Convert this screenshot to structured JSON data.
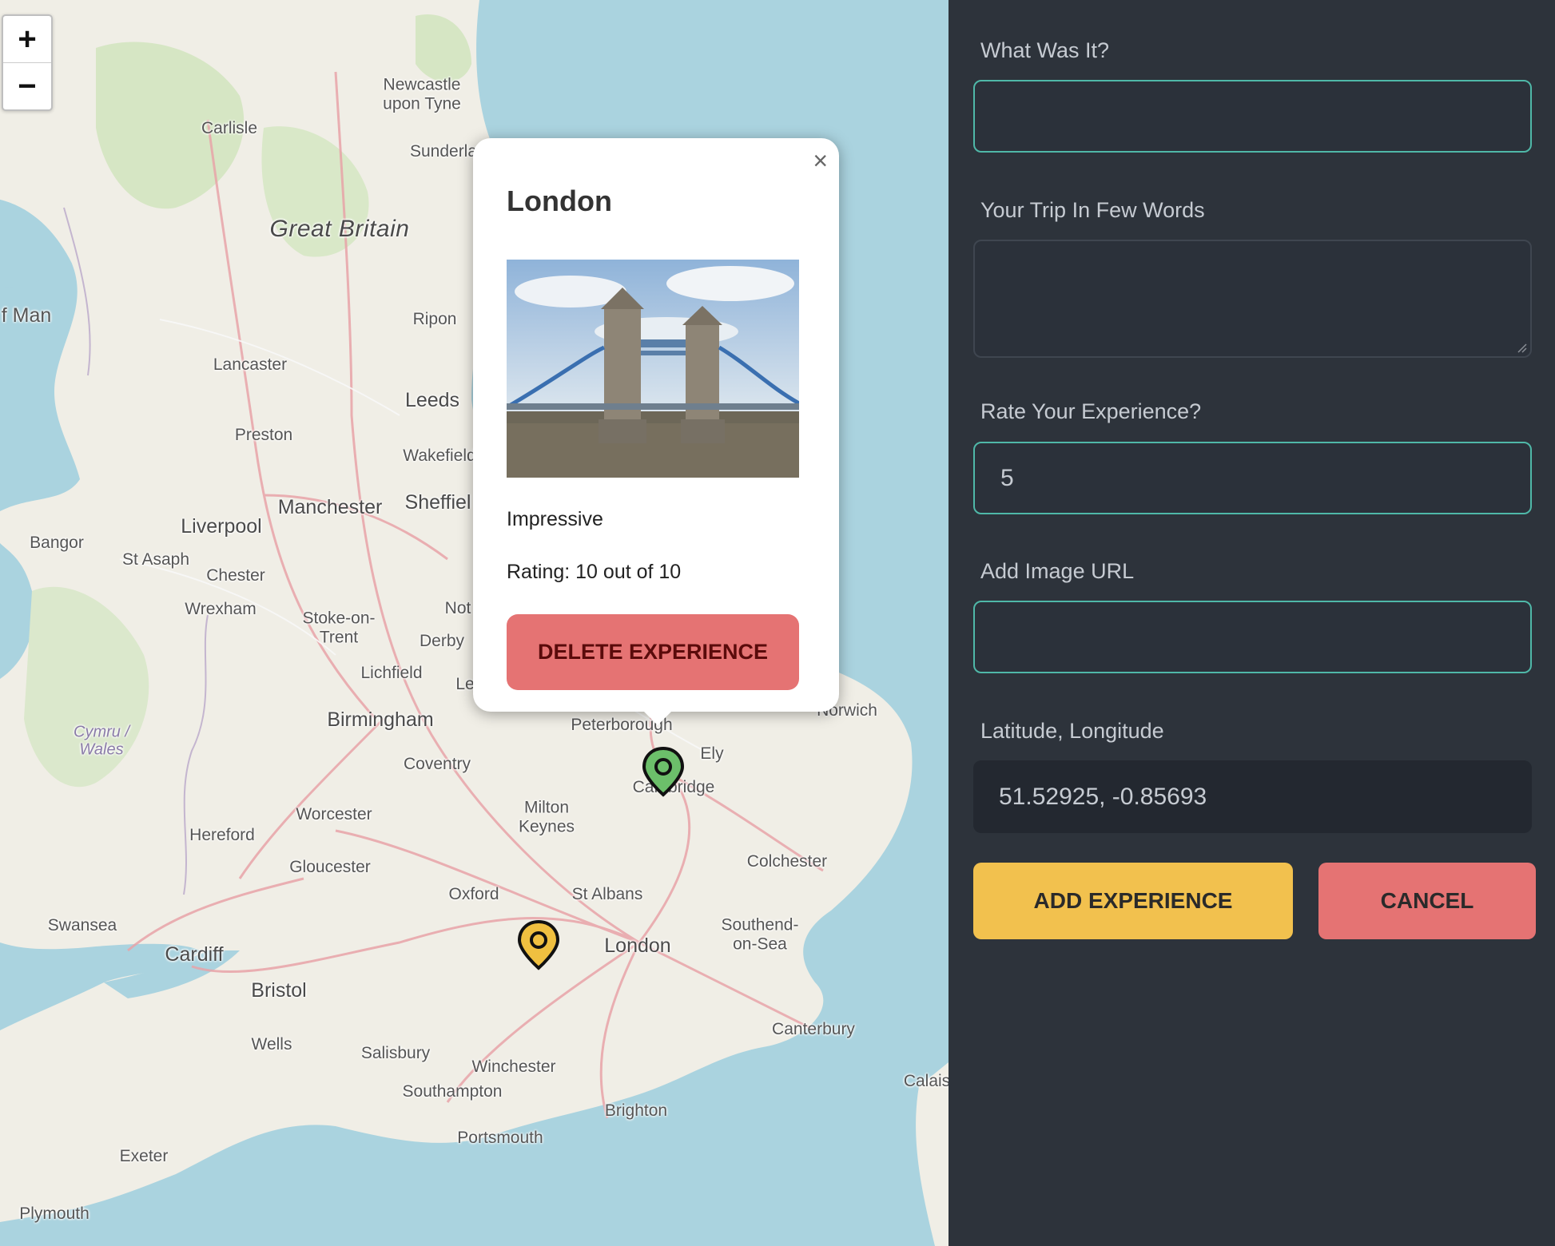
{
  "map": {
    "zoom_in": "+",
    "zoom_out": "−",
    "places": {
      "newcastle": "Newcastle\nupon Tyne",
      "sunderland": "Sunderla",
      "carlisle": "Carlisle",
      "great_britain": "Great Britain",
      "man": "f Man",
      "ripon": "Ripon",
      "lancaster": "Lancaster",
      "leeds": "Leeds",
      "preston": "Preston",
      "wakefield": "Wakefield",
      "manchester": "Manchester",
      "sheffield": "Sheffiel",
      "liverpool": "Liverpool",
      "bangor": "Bangor",
      "st_asaph": "St Asaph",
      "chester": "Chester",
      "wrexham": "Wrexham",
      "stoke": "Stoke-on-\nTrent",
      "nottingham": "Not",
      "derby": "Derby",
      "lichfield": "Lichfield",
      "leicester": "Le",
      "birmingham": "Birmingham",
      "cymru": "Cymru /\nWales",
      "coventry": "Coventry",
      "peterborough": "Peterborough",
      "norwich": "Norwich",
      "ely": "Ely",
      "cambridge": "Cambridge",
      "worcester": "Worcester",
      "milton_keynes": "Milton\nKeynes",
      "hereford": "Hereford",
      "gloucester": "Gloucester",
      "colchester": "Colchester",
      "oxford": "Oxford",
      "st_albans": "St Albans",
      "swansea": "Swansea",
      "cardiff": "Cardiff",
      "london": "London",
      "southend": "Southend-\non-Sea",
      "bristol": "Bristol",
      "wells": "Wells",
      "salisbury": "Salisbury",
      "winchester": "Winchester",
      "canterbury": "Canterbury",
      "southampton": "Southampton",
      "calais": "Calais",
      "brighton": "Brighton",
      "portsmouth": "Portsmouth",
      "exeter": "Exeter",
      "plymouth": "Plymouth"
    },
    "markers": {
      "green_color": "#6cbf6a",
      "yellow_color": "#f0c040"
    }
  },
  "popup": {
    "close": "×",
    "title": "London",
    "photo_alt": "Tower Bridge",
    "description": "Impressive",
    "rating": "Rating: 10 out of 10",
    "delete_label": "DELETE EXPERIENCE",
    "delete_color": "#e57373"
  },
  "form": {
    "what_label": "What Was It?",
    "what_value": "",
    "trip_label": "Your Trip In Few Words",
    "trip_value": "",
    "rate_label": "Rate Your Experience?",
    "rate_value": "5",
    "image_label": "Add Image URL",
    "image_value": "",
    "latlng_label": "Latitude, Longitude",
    "latlng_value": "51.52925, -0.85693",
    "add_label": "ADD EXPERIENCE",
    "add_color": "#f2c14e",
    "cancel_label": "CANCEL",
    "cancel_color": "#e57373",
    "accent_color": "#4fb8a8"
  }
}
